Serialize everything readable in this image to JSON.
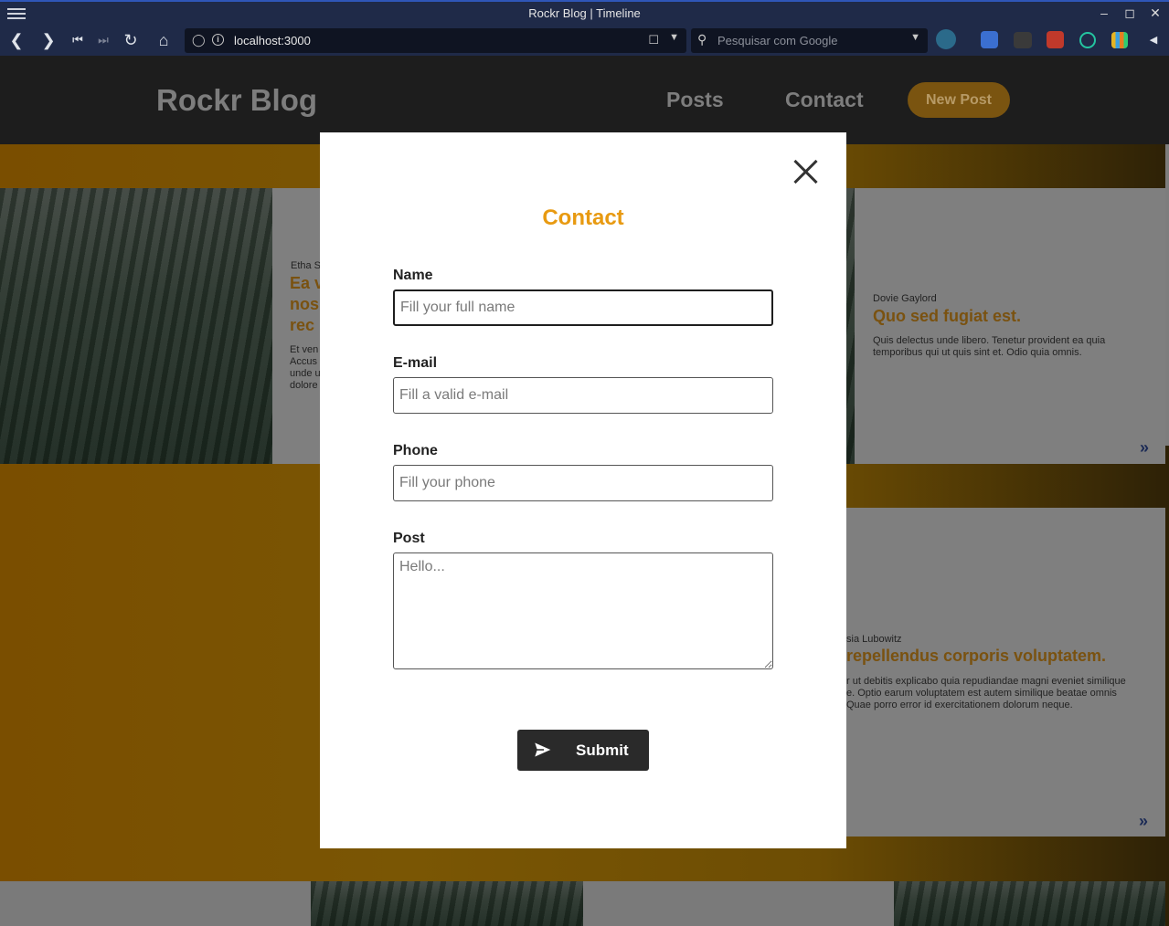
{
  "browser": {
    "window_title": "Rockr Blog | Timeline",
    "url": "localhost:3000",
    "search_placeholder": "Pesquisar com Google"
  },
  "site": {
    "brand": "Rockr Blog",
    "nav": {
      "posts": "Posts",
      "contact": "Contact"
    },
    "new_post_label": "New Post"
  },
  "posts": [
    {
      "author": "Etha S",
      "title_lines": [
        "Ea v",
        "nos",
        "rec"
      ],
      "excerpt_lines": [
        "Et ven",
        "Accus",
        "unde u",
        "dolore"
      ]
    },
    {
      "author": "Dovie Gaylord",
      "title": "Quo sed fugiat est.",
      "excerpt_lines": [
        "Quis delectus unde libero. Tenetur provident ea quia",
        "temporibus qui ut quis sint et. Odio quia omnis."
      ]
    },
    {
      "author": "sia Lubowitz",
      "title": "repellendus corporis voluptatem.",
      "excerpt_lines": [
        "r ut debitis explicabo quia repudiandae magni eveniet similique",
        "e. Optio earum voluptatem est autem similique beatae omnis",
        "Quae porro error id exercitationem dolorum neque."
      ]
    }
  ],
  "more_glyph": "»",
  "modal": {
    "title": "Contact",
    "fields": {
      "name": {
        "label": "Name",
        "placeholder": "Fill your full name",
        "value": ""
      },
      "email": {
        "label": "E-mail",
        "placeholder": "Fill a valid e-mail",
        "value": ""
      },
      "phone": {
        "label": "Phone",
        "placeholder": "Fill your phone",
        "value": ""
      },
      "post": {
        "label": "Post",
        "placeholder": "Hello...",
        "value": ""
      }
    },
    "submit_label": "Submit"
  },
  "colors": {
    "accent": "#e89a11",
    "browser_chrome": "#1f2a48",
    "submit_bg": "#2a2a2a"
  }
}
